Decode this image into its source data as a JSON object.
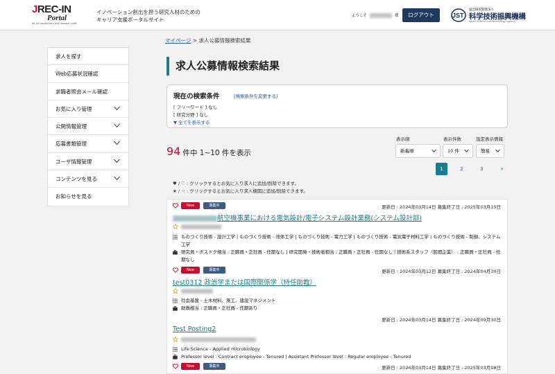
{
  "header": {
    "logo_line1": "REC-IN",
    "logo_j": "J",
    "logo_line2": "Portal",
    "logo_line3": "for all researchers and research staff",
    "tagline_1": "イノベーション創出を担う研究人材のための",
    "tagline_2": "キャリア支援ポータルサイト",
    "welcome_prefix": "ようこそ",
    "welcome_suffix": "様",
    "logout_label": "ログアウト",
    "jst_small": "国立研究開発法人",
    "jst_name": "科学技術振興機構",
    "jst_en": "Japan Science and Technology Agency"
  },
  "sidebar": {
    "items": [
      {
        "label": "求人を探す"
      },
      {
        "label": "Web応募状況確認"
      },
      {
        "label": "求職者照会メール確認"
      },
      {
        "label": "お気に入り管理"
      },
      {
        "label": "公開情報管理"
      },
      {
        "label": "応募書類管理"
      },
      {
        "label": "ユーザ情報管理"
      },
      {
        "label": "コンテンツを見る"
      },
      {
        "label": "お知らせを見る"
      }
    ]
  },
  "breadcrumb": {
    "home": "マイページ",
    "separator": ">",
    "current": "求人公募情報検索結果"
  },
  "page_title": "求人公募情報検索結果",
  "conditions": {
    "title": "現在の検索条件",
    "change_link": "[検索条件を変更する]",
    "line1": "[ フリーワード ]  なし",
    "line2": "[ 研究分野 ]  なし",
    "show_all": "▼ 全てを表示する"
  },
  "results": {
    "count": "94",
    "range_text": "件中 1~10 件を表示"
  },
  "controls": {
    "sort_label": "表示順",
    "sort_value": "新着順",
    "per_page_label": "表示件数",
    "per_page_value": "10 件",
    "view_label": "設定表示情報",
    "view_value": "簡易"
  },
  "pagination": {
    "pages": [
      "1",
      "2",
      "3",
      "»"
    ],
    "active": "1"
  },
  "legend": {
    "heart_text": "♥ / ♡ : クリックするとお気に入り求人に追加/削除できます。",
    "star_text": "★ / ☆ : クリックするとお気に入り求人機関に追加/削除できます。"
  },
  "badges": {
    "new": "New",
    "open": "募集中"
  },
  "jobs": [
    {
      "dates": "更新日 : 2024年03月14日   募集終了日 : 2025年03月15日",
      "title": "航空機事業における電気設計/電子システム設計業務(システム設計部)",
      "field": "ものづくり技術 - 設計工学 | ものづくり技術 - 流体工学 | ものづくり技術 - 電力工学 | ものづくり技術 - 電気電子材料工学 | ものづくり技術 - 制御、システム工学",
      "position": "研究員・ポスドク相当 : 正職員・正社員 - 任期なし | 研究開発・技術者相当 : 正職員・正社員 - 任期なし | 技術系スタッフ（民間企業） : 正職員・正社員 - 任期なし"
    },
    {
      "dates": "更新日 : 2024年03月12日   募集終了日 : 2024年04月30日",
      "title": "test0312 政治学または国際関係学（特任助教）",
      "field": "社会基盤 - 土木材料、施工、建設マネジメント",
      "position": "助教相当 : 正職員・正社員 - 任期あり"
    },
    {
      "dates": "更新日 : 2024年03月14日   募集終了日 : 2024年09月30日",
      "title": "Test Posting2",
      "field": "Life Science - Applied microbiology",
      "position": "Professor level : Contract employee - Tenured | Assistant Professor level : Regular employee - Tenured"
    },
    {
      "dates": "更新日 : 2024年03月14日   募集終了日 : 2025年03月08日"
    }
  ],
  "colors": {
    "accent_teal": "#1b7d8c",
    "red": "#c8102e",
    "navy": "#1f3a5f",
    "link": "#1a5faa"
  }
}
